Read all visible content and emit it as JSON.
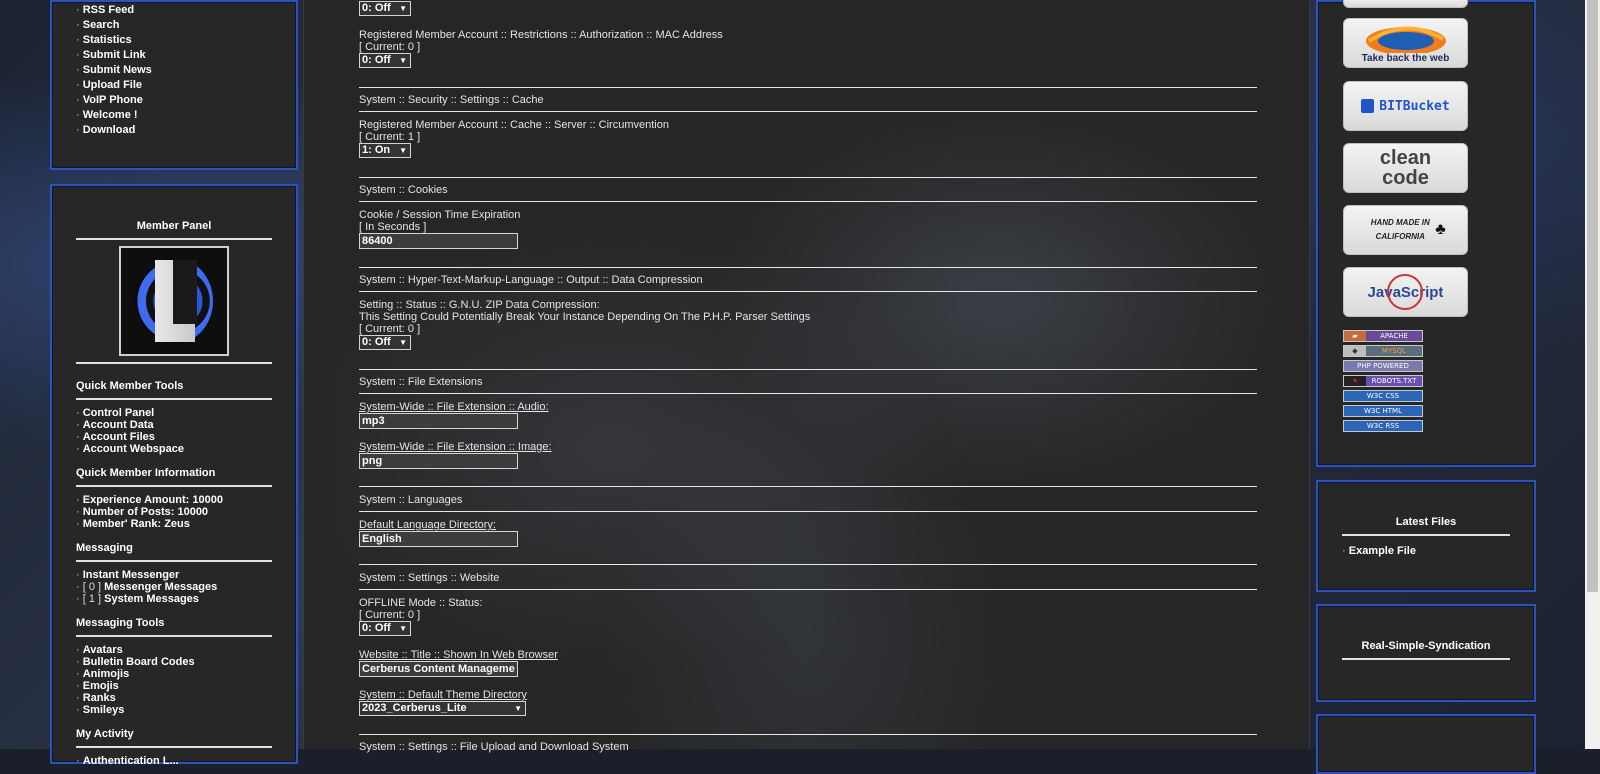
{
  "nav_links": [
    "RSS Feed",
    "Search",
    "Statistics",
    "Submit Link",
    "Submit News",
    "Upload File",
    "VoIP Phone",
    "Welcome !",
    "Download"
  ],
  "member_panel": {
    "title": "Member Panel",
    "quick_tools_title": "Quick Member Tools",
    "quick_tools": [
      "Control Panel",
      "Account Data",
      "Account Files",
      "Account Webspace"
    ],
    "quick_info_title": "Quick Member Information",
    "quick_info": [
      "Experience Amount: 10000",
      "Number of Posts: 10000",
      "Member' Rank: Zeus"
    ],
    "messaging_title": "Messaging",
    "messaging": [
      {
        "prefix": "",
        "label": "Instant Messenger"
      },
      {
        "prefix": "[ 0 ] ",
        "label": "Messenger Messages"
      },
      {
        "prefix": "[ 1 ] ",
        "label": "System Messages"
      }
    ],
    "messaging_tools_title": "Messaging Tools",
    "messaging_tools": [
      "Avatars",
      "Bulletin Board Codes",
      "Animojis",
      "Emojis",
      "Ranks",
      "Smileys"
    ],
    "activity_title": "My Activity",
    "activity_first": "Authentication L..."
  },
  "settings": {
    "mac": {
      "label": "Registered Member Account :: Restrictions :: Authorization :: MAC Address",
      "current": "[ Current: 0 ]",
      "value": "0: Off"
    },
    "top_select_value": "0: Off",
    "cache_header": "System :: Security :: Settings :: Cache",
    "cache": {
      "label": "Registered Member Account :: Cache :: Server :: Circumvention",
      "current": "[ Current: 1 ]",
      "value": "1: On"
    },
    "cookies_header": "System :: Cookies",
    "cookie": {
      "label": "Cookie / Session Time Expiration",
      "hint": "[ In Seconds ]",
      "value": "86400"
    },
    "html_header": "System :: Hyper-Text-Markup-Language :: Output :: Data Compression",
    "gzip": {
      "label": "Setting :: Status :: G.N.U. ZIP Data Compression:",
      "note": "This Setting Could Potentially Break Your Instance Depending On The P.H.P. Parser Settings",
      "current": "[ Current: 0 ]",
      "value": "0: Off"
    },
    "ext_header": "System :: File Extensions",
    "ext_audio": {
      "label": "System-Wide :: File Extension :: Audio:",
      "value": "mp3"
    },
    "ext_image": {
      "label": "System-Wide :: File Extension :: Image:",
      "value": "png"
    },
    "lang_header": "System :: Languages",
    "lang": {
      "label": "Default Language Directory:",
      "value": "English"
    },
    "website_header": "System :: Settings :: Website",
    "offline": {
      "label": "OFFLINE Mode :: Status:",
      "current": "[ Current: 0 ]",
      "value": "0: Off"
    },
    "site_title": {
      "label": "Website :: Title :: Shown In Web Browser",
      "value": "Cerberus Content Manageme"
    },
    "theme": {
      "label": "System :: Default Theme Directory",
      "value": "2023_Cerberus_Lite"
    },
    "upload_header": "System :: Settings :: File Upload and Download System"
  },
  "badges": {
    "large": [
      "Take back the web",
      "BITBucket",
      "clean code",
      "HAND MADE IN CALIFORNIA",
      "JavaScript"
    ],
    "small": [
      "APACHE",
      "MYSQL",
      "PHP POWERED",
      "ROBOTS.TXT",
      "W3C CSS",
      "W3C HTML",
      "W3C RSS"
    ]
  },
  "right_blocks": {
    "latest_files_title": "Latest Files",
    "latest_files": [
      "Example File"
    ],
    "rss_title": "Real-Simple-Syndication"
  },
  "colors": {
    "accent": "#2f52b8",
    "panel": "#272727",
    "text": "#e6e6e6"
  }
}
